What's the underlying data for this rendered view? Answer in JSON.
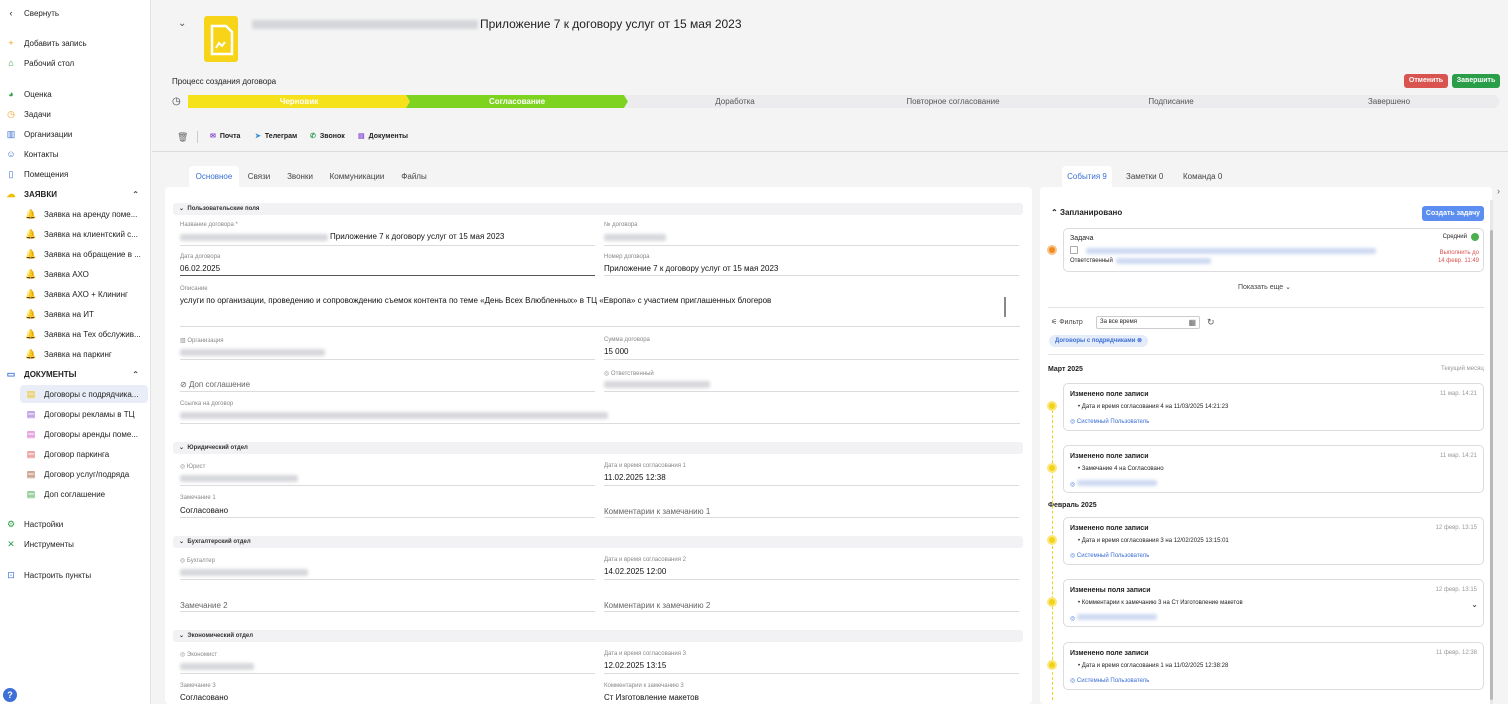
{
  "sidebar": {
    "collapse": "Свернуть",
    "add_record": "Добавить запись",
    "desktop": "Рабочий стол",
    "rating": "Оценка",
    "tasks": "Задачи",
    "organizations": "Организации",
    "contacts": "Контакты",
    "premises": "Помещения",
    "requests_section": "ЗАЯВКИ",
    "requests": [
      "Заявка на аренду поме...",
      "Заявка на клиентский с...",
      "Заявка на обращение в ...",
      "Заявка АХО",
      "Заявка АХО + Клининг",
      "Заявка на ИТ",
      "Заявка на Тех обслужив...",
      "Заявка на паркинг"
    ],
    "documents_section": "ДОКУМЕНТЫ",
    "documents": [
      "Договоры с подрядчика...",
      "Договоры рекламы в ТЦ",
      "Договоры аренды поме...",
      "Договор паркинга",
      "Договор услуг/подряда",
      "Доп соглашение"
    ],
    "settings": "Настройки",
    "tools": "Инструменты",
    "configure": "Настроить пункты",
    "help": "?"
  },
  "header": {
    "title": "Приложение 7 к договору услуг от 15 мая 2023",
    "process_label": "Процесс создания договора",
    "cancel_label": "Отменить",
    "finish_label": "Завершить",
    "stages": [
      "Черновик",
      "Согласование",
      "Доработка",
      "Повторное согласование",
      "Подписание",
      "Завершено"
    ],
    "stage_colors": [
      "#f5e21a",
      "#7ed321",
      "#ececef",
      "#ececef",
      "#ececef",
      "#ececef"
    ],
    "actions": [
      "Почта",
      "Телеграм",
      "Звонок",
      "Документы"
    ]
  },
  "tabs": [
    "Основное",
    "Связи",
    "Звонки",
    "Коммуникации",
    "Файлы"
  ],
  "form": {
    "custom_section": "Пользовательские поля",
    "contract_name_label": "Название договора *",
    "contract_name_value": "Приложение 7  к договору услуг от 15 мая 2023",
    "contract_no_label": "№ договора",
    "contract_date_label": "Дата договора",
    "contract_date_value": "06.02.2025",
    "contract_number_label": "Номер договора",
    "contract_number_value": "Приложение 7  к договору услуг от 15 мая 2023",
    "description_label": "Описание",
    "description_value": "услуги по организации, проведению и сопровождению съемок контента по теме «День Всех Влюбленных» в ТЦ «Европа» с участием приглашенных блогеров",
    "organization_label": "Организация",
    "amount_label": "Сумма договора",
    "amount_value": "15 000",
    "addendum_label": "Доп соглашение",
    "responsible_label": "Ответственный",
    "link_label": "Ссылка на договор",
    "legal_section": "Юридический отдел",
    "lawyer_label": "Юрист",
    "approval1_label": "Дата и время согласования 1",
    "approval1_value": "11.02.2025 12:38",
    "remark1_label": "Замечание 1",
    "remark1_value": "Согласовано",
    "remark1_comment": "Комментарии к замечанию 1",
    "acc_section": "Бухгалтерский отдел",
    "accountant_label": "Бухгалтер",
    "approval2_label": "Дата и время согласования 2",
    "approval2_value": "14.02.2025 12:00",
    "remark2_label": "Замечание 2",
    "remark2_comment": "Комментарии к замечанию 2",
    "eco_section": "Экономический отдел",
    "economist_label": "Экономист",
    "approval3_label": "Дата и время согласования 3",
    "approval3_value": "12.02.2025 13:15",
    "remark3_label": "Замечание 3",
    "remark3_value": "Согласовано",
    "remark3_comment_label": "Комментарии к замечанию 3",
    "remark3_comment_value": "Ст Изготовление макетов"
  },
  "right": {
    "tabs": [
      "События 9",
      "Заметки 0",
      "Команда 0"
    ],
    "planned": "Запланировано",
    "create_task": "Создать задачу",
    "task_label": "Задача",
    "priority": "Средний",
    "responsible": "Ответственный",
    "due": "Выполнить до",
    "due_date": "14 февр. 11:49",
    "show_more": "Показать еще",
    "filter": "Фильтр",
    "filter_value": "За все время",
    "chip": "Договоры с подрядчиками",
    "march": "Март 2025",
    "current_month": "Текущий месяц",
    "february": "Февраль 2025",
    "events": [
      {
        "title": "Изменено поле записи",
        "date": "11 мар. 14:21",
        "body": "Дата и время согласования 4 на 11/03/2025 14:21:23",
        "user": "Системный Пользователь"
      },
      {
        "title": "Изменено поле записи",
        "date": "11 мар. 14:21",
        "body": "Замечание 4 на Согласовано",
        "user": ""
      },
      {
        "title": "Изменено поле записи",
        "date": "12 февр. 13:15",
        "body": "Дата и время согласования 3 на 12/02/2025 13:15:01",
        "user": "Системный Пользователь"
      },
      {
        "title": "Изменены поля записи",
        "date": "12 февр. 13:15",
        "body": "Комментарии к замечанию 3 на Ст Изготовление макетов",
        "user": ""
      },
      {
        "title": "Изменено поле записи",
        "date": "11 февр. 12:38",
        "body": "Дата и время согласования 1 на 11/02/2025 12:38:28",
        "user": "Системный Пользователь"
      }
    ]
  }
}
